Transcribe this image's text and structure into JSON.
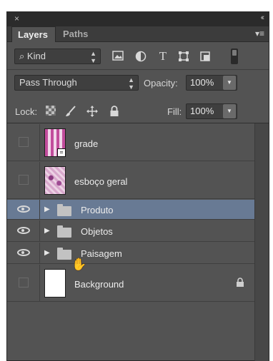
{
  "panel": {
    "close_glyph": "×",
    "collapse_glyph": "‹‹",
    "menu_glyph": "▾≡"
  },
  "tabs": [
    {
      "label": "Layers",
      "active": true
    },
    {
      "label": "Paths",
      "active": false
    }
  ],
  "filter": {
    "kind_label": "Kind",
    "kind_icon": "search-icon",
    "arrows": "⬍",
    "icons": [
      "image-filter-icon",
      "adjustment-filter-icon",
      "type-filter-icon",
      "shape-filter-icon",
      "smart-object-filter-icon"
    ]
  },
  "blend": {
    "mode": "Pass Through",
    "opacity_label": "Opacity:",
    "opacity_value": "100%"
  },
  "lock": {
    "label": "Lock:",
    "icons": [
      "lock-transparent-pixels-icon",
      "lock-image-pixels-icon",
      "lock-position-icon",
      "lock-all-icon"
    ],
    "fill_label": "Fill:",
    "fill_value": "100%"
  },
  "layers": [
    {
      "name": "grade",
      "type": "smart-object",
      "visible": false,
      "selected": false
    },
    {
      "name": "esboço geral",
      "type": "pixel",
      "visible": false,
      "selected": false
    },
    {
      "name": "Produto",
      "type": "group",
      "visible": true,
      "selected": true
    },
    {
      "name": "Objetos",
      "type": "group",
      "visible": true,
      "selected": false
    },
    {
      "name": "Paisagem",
      "type": "group",
      "visible": true,
      "selected": false
    },
    {
      "name": "Background",
      "type": "background",
      "visible": false,
      "selected": false,
      "locked": true
    }
  ],
  "colors": {
    "panel_bg": "#535353",
    "selected_row": "#687a94",
    "titlebar": "#2b2b2b"
  }
}
